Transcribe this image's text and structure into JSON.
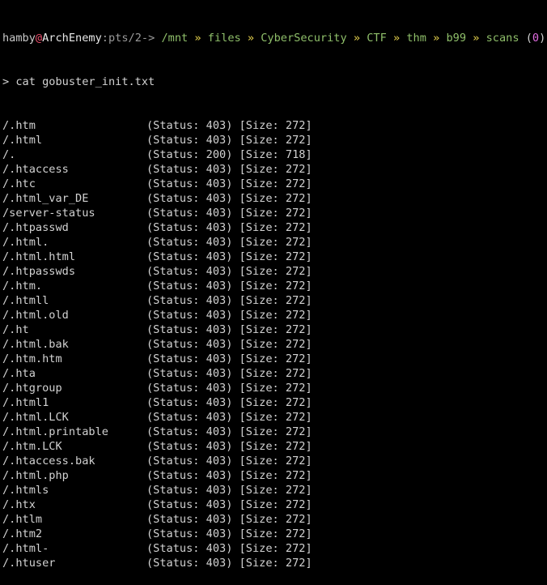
{
  "prompt": {
    "user": "hamby",
    "at": "@",
    "host": "ArchEnemy",
    "tty": ":pts/2->",
    "path_segments": [
      "/mnt",
      "files",
      "CyberSecurity",
      "CTF",
      "thm",
      "b99",
      "scans"
    ],
    "separator": "»",
    "exit_open": "(",
    "exit_code": "0",
    "exit_close": ")"
  },
  "command": "> cat gobuster_init.txt",
  "results": [
    {
      "path": "/.htm",
      "status": "403",
      "size": "272"
    },
    {
      "path": "/.html",
      "status": "403",
      "size": "272"
    },
    {
      "path": "/.",
      "status": "200",
      "size": "718"
    },
    {
      "path": "/.htaccess",
      "status": "403",
      "size": "272"
    },
    {
      "path": "/.htc",
      "status": "403",
      "size": "272"
    },
    {
      "path": "/.html_var_DE",
      "status": "403",
      "size": "272"
    },
    {
      "path": "/server-status",
      "status": "403",
      "size": "272"
    },
    {
      "path": "/.htpasswd",
      "status": "403",
      "size": "272"
    },
    {
      "path": "/.html.",
      "status": "403",
      "size": "272"
    },
    {
      "path": "/.html.html",
      "status": "403",
      "size": "272"
    },
    {
      "path": "/.htpasswds",
      "status": "403",
      "size": "272"
    },
    {
      "path": "/.htm.",
      "status": "403",
      "size": "272"
    },
    {
      "path": "/.htmll",
      "status": "403",
      "size": "272"
    },
    {
      "path": "/.html.old",
      "status": "403",
      "size": "272"
    },
    {
      "path": "/.ht",
      "status": "403",
      "size": "272"
    },
    {
      "path": "/.html.bak",
      "status": "403",
      "size": "272"
    },
    {
      "path": "/.htm.htm",
      "status": "403",
      "size": "272"
    },
    {
      "path": "/.hta",
      "status": "403",
      "size": "272"
    },
    {
      "path": "/.htgroup",
      "status": "403",
      "size": "272"
    },
    {
      "path": "/.html1",
      "status": "403",
      "size": "272"
    },
    {
      "path": "/.html.LCK",
      "status": "403",
      "size": "272"
    },
    {
      "path": "/.html.printable",
      "status": "403",
      "size": "272"
    },
    {
      "path": "/.htm.LCK",
      "status": "403",
      "size": "272"
    },
    {
      "path": "/.htaccess.bak",
      "status": "403",
      "size": "272"
    },
    {
      "path": "/.html.php",
      "status": "403",
      "size": "272"
    },
    {
      "path": "/.htmls",
      "status": "403",
      "size": "272"
    },
    {
      "path": "/.htx",
      "status": "403",
      "size": "272"
    },
    {
      "path": "/.htlm",
      "status": "403",
      "size": "272"
    },
    {
      "path": "/.htm2",
      "status": "403",
      "size": "272"
    },
    {
      "path": "/.html-",
      "status": "403",
      "size": "272"
    },
    {
      "path": "/.htuser",
      "status": "403",
      "size": "272"
    }
  ],
  "colors": {
    "background": "#000000",
    "text": "#d2d2d2",
    "path": "#8fbf6a",
    "separator": "#e8d44d",
    "at": "#f0506e",
    "exit_code": "#e06ce0"
  }
}
